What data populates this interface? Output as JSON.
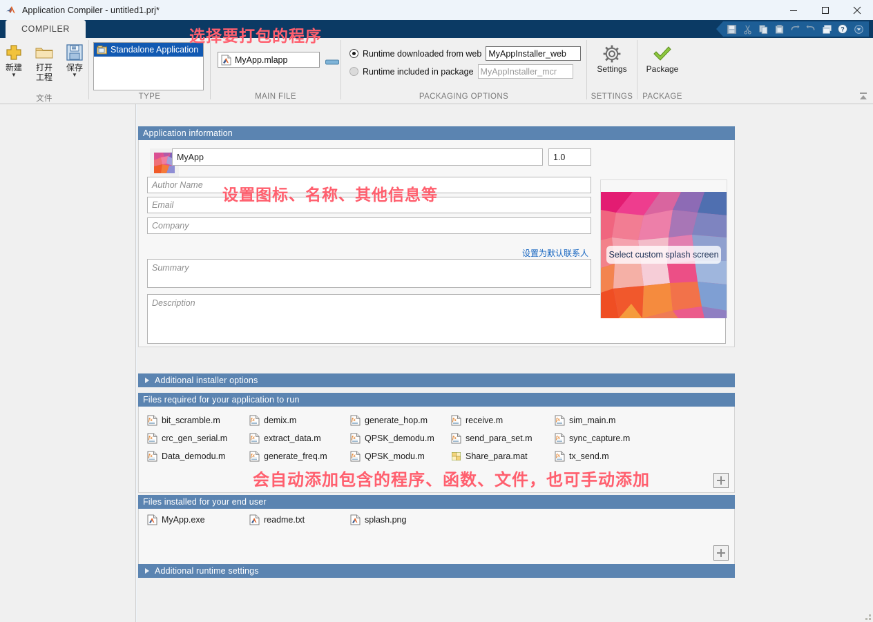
{
  "window": {
    "title": "Application Compiler - untitled1.prj*",
    "app_icon": "matlab-icon",
    "minimize": "—",
    "maximize": "□",
    "close": "✕"
  },
  "ribbon": {
    "tab_label": "COMPILER",
    "quick_access": [
      {
        "name": "save-icon",
        "glyph": "save"
      },
      {
        "name": "cut-icon",
        "glyph": "cut"
      },
      {
        "name": "copy-icon",
        "glyph": "copy"
      },
      {
        "name": "paste-icon",
        "glyph": "paste"
      },
      {
        "name": "undo-icon",
        "glyph": "undo"
      },
      {
        "name": "redo-icon",
        "glyph": "redo"
      },
      {
        "name": "layout-icon",
        "glyph": "layout"
      },
      {
        "name": "help-icon",
        "glyph": "help"
      },
      {
        "name": "customize-dropdown-icon",
        "glyph": "chevron-down"
      }
    ],
    "file_group": {
      "label": "文件",
      "new": "新建",
      "open_line1": "打开",
      "open_line2": "工程",
      "save": "保存"
    },
    "type_group": {
      "label": "TYPE",
      "selected_item": "Standalone Application"
    },
    "main_file_group": {
      "label": "MAIN FILE",
      "file": "MyApp.mlapp"
    },
    "packaging_group": {
      "label": "PACKAGING OPTIONS",
      "option_web": "Runtime downloaded from web",
      "option_web_value": "MyAppInstaller_web",
      "option_included": "Runtime included in package",
      "option_included_value": "MyAppInstaller_mcr",
      "selected": "web"
    },
    "settings_group": {
      "label": "SETTINGS",
      "button": "Settings"
    },
    "package_group": {
      "label": "PACKAGE",
      "button": "Package"
    }
  },
  "app_information": {
    "panel_title": "Application information",
    "name_value": "MyApp",
    "version_value": "1.0",
    "author_placeholder": "Author Name",
    "email_placeholder": "Email",
    "company_placeholder": "Company",
    "set_default_contact": "设置为默认联系人",
    "summary_placeholder": "Summary",
    "description_placeholder": "Description",
    "splash_label": "Select custom splash screen"
  },
  "additional_installer_options": {
    "title": "Additional installer options"
  },
  "files_required": {
    "title": "Files required for your application to run",
    "items": [
      {
        "name": "bit_scramble.m",
        "icon": "m-file-icon"
      },
      {
        "name": "crc_gen_serial.m",
        "icon": "m-file-icon"
      },
      {
        "name": "Data_demodu.m",
        "icon": "m-file-icon"
      },
      {
        "name": "demix.m",
        "icon": "m-file-icon"
      },
      {
        "name": "extract_data.m",
        "icon": "m-file-icon"
      },
      {
        "name": "generate_freq.m",
        "icon": "m-file-icon"
      },
      {
        "name": "generate_hop.m",
        "icon": "m-file-icon"
      },
      {
        "name": "QPSK_demodu.m",
        "icon": "m-file-icon"
      },
      {
        "name": "QPSK_modu.m",
        "icon": "m-file-icon"
      },
      {
        "name": "receive.m",
        "icon": "m-file-icon"
      },
      {
        "name": "send_para_set.m",
        "icon": "m-file-icon"
      },
      {
        "name": "Share_para.mat",
        "icon": "mat-file-icon"
      },
      {
        "name": "sim_main.m",
        "icon": "m-file-icon"
      },
      {
        "name": "sync_capture.m",
        "icon": "m-file-icon"
      },
      {
        "name": "tx_send.m",
        "icon": "m-file-icon"
      }
    ],
    "add_button": "+"
  },
  "files_installed": {
    "title": "Files installed for your end user",
    "items": [
      {
        "name": "MyApp.exe",
        "icon": "matlab-file-icon"
      },
      {
        "name": "readme.txt",
        "icon": "matlab-file-icon"
      },
      {
        "name": "splash.png",
        "icon": "matlab-file-icon"
      }
    ],
    "add_button": "+"
  },
  "additional_runtime_settings": {
    "title": "Additional runtime settings"
  },
  "annotations": [
    {
      "id": "anno-select-program",
      "text": "选择要打包的程序"
    },
    {
      "id": "anno-set-icon-name",
      "text": "设置图标、名称、其他信息等"
    },
    {
      "id": "anno-auto-add",
      "text": "会自动添加包含的程序、函数、文件，也可手动添加"
    }
  ],
  "colors": {
    "ribbon_tabstrip": "#0b3a64",
    "panel_header": "#5b84b1",
    "selection_blue": "#1159b2",
    "link_blue": "#1565c0",
    "annotation_red": "#ff5f6e"
  }
}
